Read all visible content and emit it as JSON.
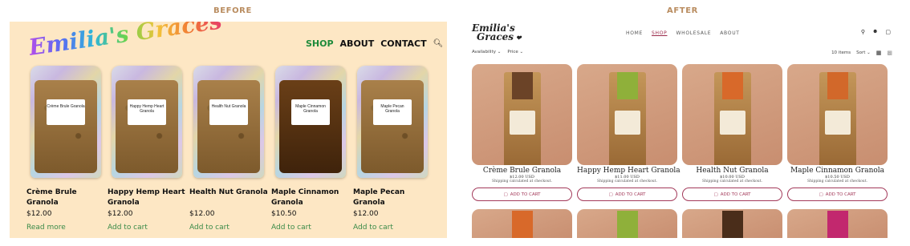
{
  "captions": {
    "before": "BEFORE",
    "after": "AFTER"
  },
  "before": {
    "logo": "Emilia's Graces",
    "nav": {
      "shop": "SHOP",
      "about": "ABOUT",
      "contact": "CONTACT"
    },
    "products": [
      {
        "name": "Crème Brule Granola",
        "price": "$12.00",
        "link": "Read more",
        "label": "Crème Brule Granola",
        "dark": false
      },
      {
        "name": "Happy Hemp Heart Granola",
        "price": "$12.00",
        "link": "Add to cart",
        "label": "Happy Hemp Heart Granola",
        "dark": false
      },
      {
        "name": "Health Nut Granola",
        "price": "$12.00",
        "link": "Add to cart",
        "label": "Health Nut Granola",
        "dark": false
      },
      {
        "name": "Maple Cinnamon Granola",
        "price": "$10.50",
        "link": "Add to cart",
        "label": "Maple Cinnamon Granola",
        "dark": true
      },
      {
        "name": "Maple Pecan Granola",
        "price": "$12.00",
        "link": "Add to cart",
        "label": "Maple Pecan Granola",
        "dark": false
      }
    ]
  },
  "after": {
    "logo_line1": "Emilia's",
    "logo_line2": "Graces",
    "nav": {
      "home": "HOME",
      "shop": "SHOP",
      "wholesale": "WHOLESALE",
      "about": "ABOUT"
    },
    "filters": {
      "availability": "Availability",
      "price": "Price"
    },
    "count": "10 items",
    "sort": "Sort",
    "add_label": "ADD TO CART",
    "products": [
      {
        "name": "Crème Brule Granola",
        "price": "$12.00 USD",
        "ship": "Shipping calculated at checkout.",
        "strip": "#6b4327"
      },
      {
        "name": "Happy Hemp Heart Granola",
        "price": "$11.00 USD",
        "ship": "Shipping calculated at checkout.",
        "strip": "#8fb03a"
      },
      {
        "name": "Health Nut Granola",
        "price": "$10.00 USD",
        "ship": "Shipping calculated at checkout.",
        "strip": "#d8692a"
      },
      {
        "name": "Maple Cinnamon Granola",
        "price": "$10.50 USD",
        "ship": "Shipping calculated at checkout.",
        "strip": "#d2682a"
      }
    ],
    "row2_strips": [
      "#d8692a",
      "#8fb03a",
      "#4a2d1a",
      "#c2286e"
    ]
  }
}
